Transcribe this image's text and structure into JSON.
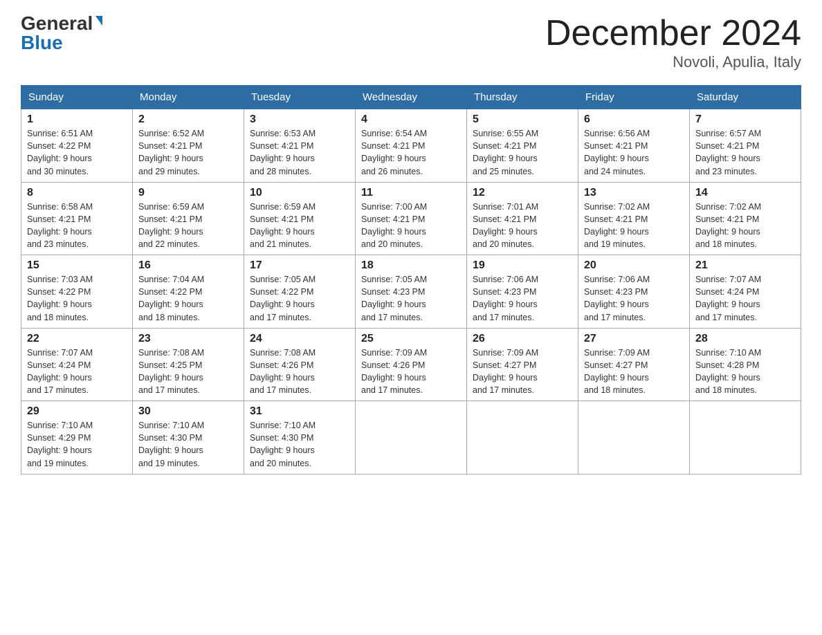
{
  "logo": {
    "general": "General",
    "blue": "Blue"
  },
  "title": "December 2024",
  "subtitle": "Novoli, Apulia, Italy",
  "days_of_week": [
    "Sunday",
    "Monday",
    "Tuesday",
    "Wednesday",
    "Thursday",
    "Friday",
    "Saturday"
  ],
  "weeks": [
    [
      {
        "day": "1",
        "sunrise": "Sunrise: 6:51 AM",
        "sunset": "Sunset: 4:22 PM",
        "daylight": "Daylight: 9 hours",
        "daylight2": "and 30 minutes."
      },
      {
        "day": "2",
        "sunrise": "Sunrise: 6:52 AM",
        "sunset": "Sunset: 4:21 PM",
        "daylight": "Daylight: 9 hours",
        "daylight2": "and 29 minutes."
      },
      {
        "day": "3",
        "sunrise": "Sunrise: 6:53 AM",
        "sunset": "Sunset: 4:21 PM",
        "daylight": "Daylight: 9 hours",
        "daylight2": "and 28 minutes."
      },
      {
        "day": "4",
        "sunrise": "Sunrise: 6:54 AM",
        "sunset": "Sunset: 4:21 PM",
        "daylight": "Daylight: 9 hours",
        "daylight2": "and 26 minutes."
      },
      {
        "day": "5",
        "sunrise": "Sunrise: 6:55 AM",
        "sunset": "Sunset: 4:21 PM",
        "daylight": "Daylight: 9 hours",
        "daylight2": "and 25 minutes."
      },
      {
        "day": "6",
        "sunrise": "Sunrise: 6:56 AM",
        "sunset": "Sunset: 4:21 PM",
        "daylight": "Daylight: 9 hours",
        "daylight2": "and 24 minutes."
      },
      {
        "day": "7",
        "sunrise": "Sunrise: 6:57 AM",
        "sunset": "Sunset: 4:21 PM",
        "daylight": "Daylight: 9 hours",
        "daylight2": "and 23 minutes."
      }
    ],
    [
      {
        "day": "8",
        "sunrise": "Sunrise: 6:58 AM",
        "sunset": "Sunset: 4:21 PM",
        "daylight": "Daylight: 9 hours",
        "daylight2": "and 23 minutes."
      },
      {
        "day": "9",
        "sunrise": "Sunrise: 6:59 AM",
        "sunset": "Sunset: 4:21 PM",
        "daylight": "Daylight: 9 hours",
        "daylight2": "and 22 minutes."
      },
      {
        "day": "10",
        "sunrise": "Sunrise: 6:59 AM",
        "sunset": "Sunset: 4:21 PM",
        "daylight": "Daylight: 9 hours",
        "daylight2": "and 21 minutes."
      },
      {
        "day": "11",
        "sunrise": "Sunrise: 7:00 AM",
        "sunset": "Sunset: 4:21 PM",
        "daylight": "Daylight: 9 hours",
        "daylight2": "and 20 minutes."
      },
      {
        "day": "12",
        "sunrise": "Sunrise: 7:01 AM",
        "sunset": "Sunset: 4:21 PM",
        "daylight": "Daylight: 9 hours",
        "daylight2": "and 20 minutes."
      },
      {
        "day": "13",
        "sunrise": "Sunrise: 7:02 AM",
        "sunset": "Sunset: 4:21 PM",
        "daylight": "Daylight: 9 hours",
        "daylight2": "and 19 minutes."
      },
      {
        "day": "14",
        "sunrise": "Sunrise: 7:02 AM",
        "sunset": "Sunset: 4:21 PM",
        "daylight": "Daylight: 9 hours",
        "daylight2": "and 18 minutes."
      }
    ],
    [
      {
        "day": "15",
        "sunrise": "Sunrise: 7:03 AM",
        "sunset": "Sunset: 4:22 PM",
        "daylight": "Daylight: 9 hours",
        "daylight2": "and 18 minutes."
      },
      {
        "day": "16",
        "sunrise": "Sunrise: 7:04 AM",
        "sunset": "Sunset: 4:22 PM",
        "daylight": "Daylight: 9 hours",
        "daylight2": "and 18 minutes."
      },
      {
        "day": "17",
        "sunrise": "Sunrise: 7:05 AM",
        "sunset": "Sunset: 4:22 PM",
        "daylight": "Daylight: 9 hours",
        "daylight2": "and 17 minutes."
      },
      {
        "day": "18",
        "sunrise": "Sunrise: 7:05 AM",
        "sunset": "Sunset: 4:23 PM",
        "daylight": "Daylight: 9 hours",
        "daylight2": "and 17 minutes."
      },
      {
        "day": "19",
        "sunrise": "Sunrise: 7:06 AM",
        "sunset": "Sunset: 4:23 PM",
        "daylight": "Daylight: 9 hours",
        "daylight2": "and 17 minutes."
      },
      {
        "day": "20",
        "sunrise": "Sunrise: 7:06 AM",
        "sunset": "Sunset: 4:23 PM",
        "daylight": "Daylight: 9 hours",
        "daylight2": "and 17 minutes."
      },
      {
        "day": "21",
        "sunrise": "Sunrise: 7:07 AM",
        "sunset": "Sunset: 4:24 PM",
        "daylight": "Daylight: 9 hours",
        "daylight2": "and 17 minutes."
      }
    ],
    [
      {
        "day": "22",
        "sunrise": "Sunrise: 7:07 AM",
        "sunset": "Sunset: 4:24 PM",
        "daylight": "Daylight: 9 hours",
        "daylight2": "and 17 minutes."
      },
      {
        "day": "23",
        "sunrise": "Sunrise: 7:08 AM",
        "sunset": "Sunset: 4:25 PM",
        "daylight": "Daylight: 9 hours",
        "daylight2": "and 17 minutes."
      },
      {
        "day": "24",
        "sunrise": "Sunrise: 7:08 AM",
        "sunset": "Sunset: 4:26 PM",
        "daylight": "Daylight: 9 hours",
        "daylight2": "and 17 minutes."
      },
      {
        "day": "25",
        "sunrise": "Sunrise: 7:09 AM",
        "sunset": "Sunset: 4:26 PM",
        "daylight": "Daylight: 9 hours",
        "daylight2": "and 17 minutes."
      },
      {
        "day": "26",
        "sunrise": "Sunrise: 7:09 AM",
        "sunset": "Sunset: 4:27 PM",
        "daylight": "Daylight: 9 hours",
        "daylight2": "and 17 minutes."
      },
      {
        "day": "27",
        "sunrise": "Sunrise: 7:09 AM",
        "sunset": "Sunset: 4:27 PM",
        "daylight": "Daylight: 9 hours",
        "daylight2": "and 18 minutes."
      },
      {
        "day": "28",
        "sunrise": "Sunrise: 7:10 AM",
        "sunset": "Sunset: 4:28 PM",
        "daylight": "Daylight: 9 hours",
        "daylight2": "and 18 minutes."
      }
    ],
    [
      {
        "day": "29",
        "sunrise": "Sunrise: 7:10 AM",
        "sunset": "Sunset: 4:29 PM",
        "daylight": "Daylight: 9 hours",
        "daylight2": "and 19 minutes."
      },
      {
        "day": "30",
        "sunrise": "Sunrise: 7:10 AM",
        "sunset": "Sunset: 4:30 PM",
        "daylight": "Daylight: 9 hours",
        "daylight2": "and 19 minutes."
      },
      {
        "day": "31",
        "sunrise": "Sunrise: 7:10 AM",
        "sunset": "Sunset: 4:30 PM",
        "daylight": "Daylight: 9 hours",
        "daylight2": "and 20 minutes."
      },
      null,
      null,
      null,
      null
    ]
  ]
}
